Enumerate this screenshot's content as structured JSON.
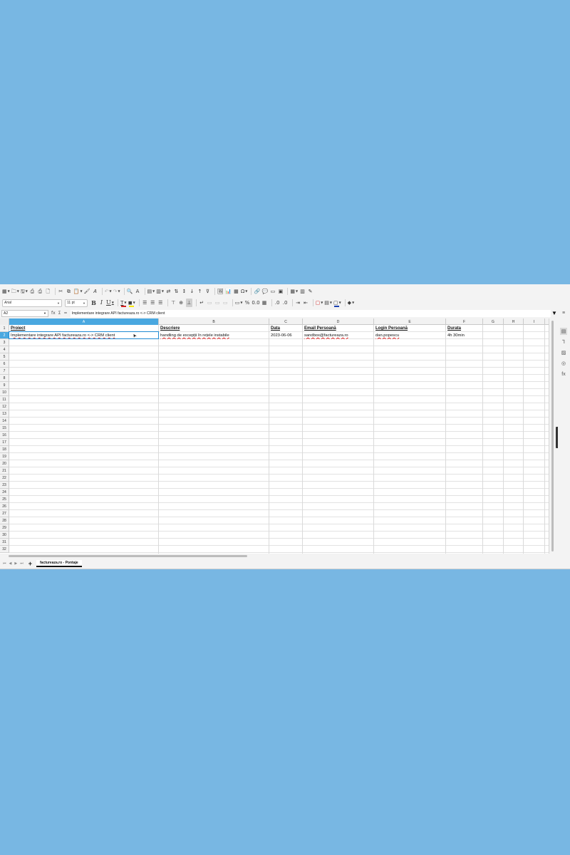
{
  "toolbar1": {
    "icons": [
      "new-spreadsheet-icon",
      "open-icon",
      "save-icon",
      "export-pdf-icon",
      "print-icon",
      "print-preview-icon",
      "cut-icon",
      "copy-icon",
      "paste-icon",
      "clone-formatting-icon",
      "clear-formatting-icon",
      "undo-icon",
      "redo-icon",
      "find-replace-icon",
      "spelling-icon",
      "row-icon",
      "column-icon",
      "insert-rows-icon",
      "insert-cols-icon",
      "sort-icon",
      "sort-asc-icon",
      "sort-desc-icon",
      "autofilter-icon",
      "image-icon",
      "chart-icon",
      "pivot-table-icon",
      "special-character-icon",
      "hyperlink-icon",
      "comment-icon",
      "header-footer-icon",
      "define-print-area-icon",
      "freeze-icon",
      "split-window-icon",
      "show-draw-functions-icon"
    ],
    "glyphs": [
      "▦",
      "🗀",
      "🖫",
      "⎙",
      "⎙",
      "🗋",
      "✂",
      "⧉",
      "📋",
      "🖌",
      "𝐴",
      "↶",
      "↷",
      "🔍",
      "A",
      "▤",
      "▥",
      "⇄",
      "⇅",
      "↕",
      "↓",
      "↑",
      "⊽",
      "🖼",
      "📊",
      "▦",
      "Ω",
      "🔗",
      "💬",
      "▭",
      "▣",
      "▦",
      "▥",
      "✎"
    ]
  },
  "toolbar2": {
    "font_name": "Arial",
    "font_size": "11 pt",
    "bold": "B",
    "italic": "I",
    "underline": "U",
    "font_color_letter": "T",
    "font_color": "#d42020",
    "highlight_color": "#f5e400",
    "border_color": "#1a3fb0",
    "cell_bg_color": "#ffffff"
  },
  "formula_bar": {
    "cell_ref": "A2",
    "fx": "fx",
    "sigma": "Σ",
    "equals": "=",
    "content": "Implementare integrare API factureaza.ro <-> CRM client"
  },
  "columns": [
    "A",
    "B",
    "C",
    "D",
    "E",
    "F",
    "G",
    "H",
    "I"
  ],
  "selected_column": "A",
  "rows": [
    "1",
    "2",
    "3",
    "4",
    "5",
    "6",
    "7",
    "8",
    "9",
    "10",
    "11",
    "12",
    "13",
    "14",
    "15",
    "16",
    "17",
    "18",
    "19",
    "20",
    "21",
    "22",
    "23",
    "24",
    "25",
    "26",
    "27",
    "28",
    "29",
    "30",
    "31",
    "32"
  ],
  "selected_row": "2",
  "headers": [
    "Proiect",
    "Descriere",
    "Data",
    "Email Persoană",
    "Login Persoană",
    "Durata"
  ],
  "data_row": [
    "Implementare integrare API factureaza.ro <-> CRM client",
    "handling de excepții în rețele instabile",
    "2023-06-06",
    "sandbox@factureaza.ro",
    "dan.popescu",
    "4h 30min"
  ],
  "sheet_tab": "factureaza.ro - Pontaje",
  "sidebar_icons": [
    "menu-icon",
    "properties-icon",
    "styles-icon",
    "gallery-icon",
    "navigator-icon",
    "functions-icon"
  ],
  "sidebar_glyphs": [
    "≡",
    "▤",
    "Ꞁ",
    "▨",
    "◎",
    "fx"
  ]
}
